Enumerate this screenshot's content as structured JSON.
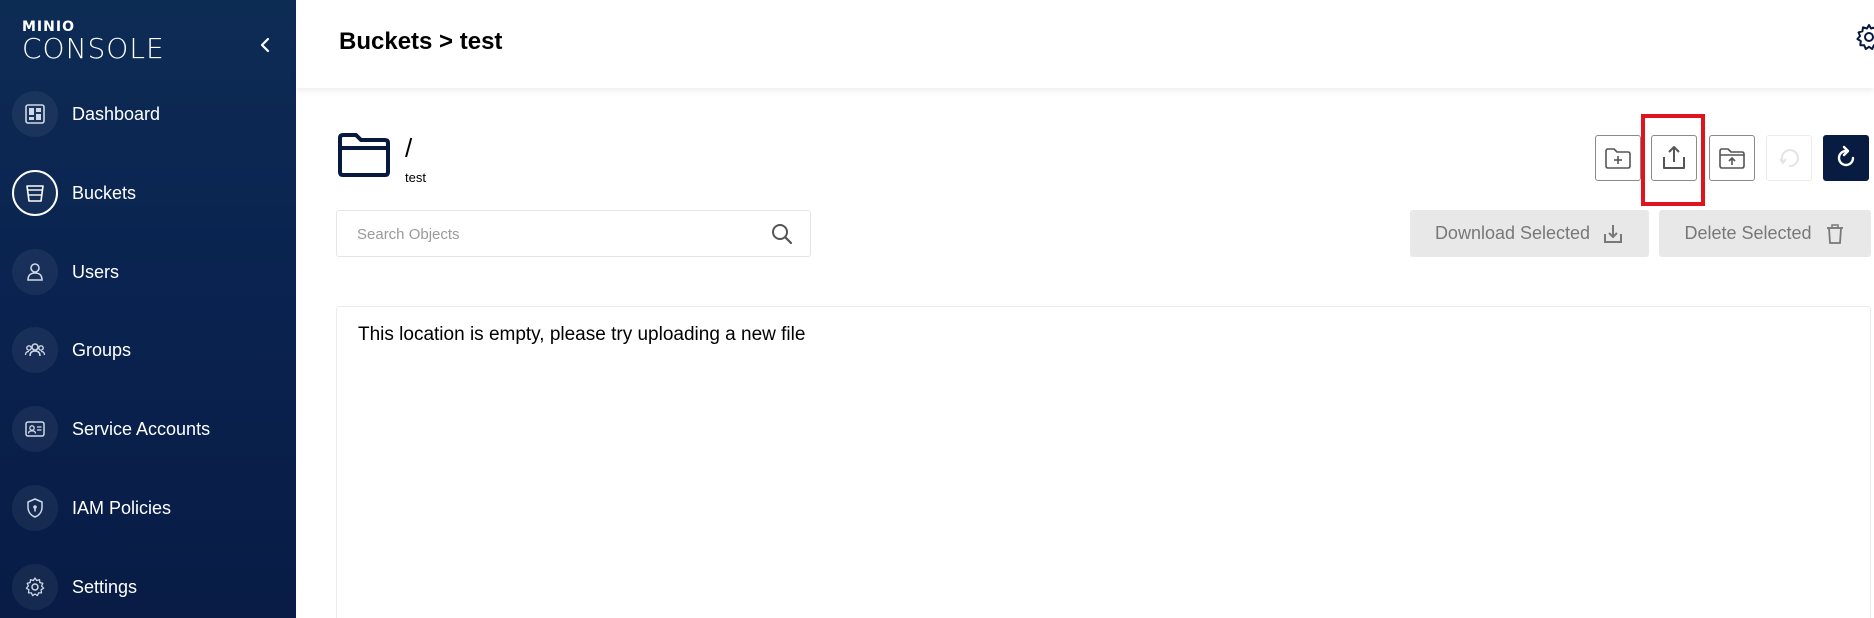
{
  "sidebar": {
    "logo": {
      "small": "MINIO",
      "big": "CONSOLE"
    },
    "items": [
      {
        "label": "Dashboard",
        "icon": "dashboard-icon"
      },
      {
        "label": "Buckets",
        "icon": "bucket-icon",
        "active": true
      },
      {
        "label": "Users",
        "icon": "user-icon"
      },
      {
        "label": "Groups",
        "icon": "groups-icon"
      },
      {
        "label": "Service Accounts",
        "icon": "service-accounts-icon"
      },
      {
        "label": "IAM Policies",
        "icon": "shield-icon"
      },
      {
        "label": "Settings",
        "icon": "gear-icon"
      }
    ]
  },
  "header": {
    "breadcrumb": "Buckets > test"
  },
  "location": {
    "path": "/",
    "bucket": "test"
  },
  "search": {
    "placeholder": "Search Objects",
    "value": ""
  },
  "toolbar": {
    "icons": [
      "create-folder-icon",
      "upload-file-icon",
      "upload-folder-icon",
      "rewind-icon",
      "refresh-icon"
    ],
    "download_label": "Download Selected",
    "delete_label": "Delete Selected"
  },
  "content": {
    "empty_message": "This location is empty, please try uploading a new file"
  },
  "colors": {
    "sidebar": "#0a2350",
    "highlight": "#e0141e",
    "refresh_button": "#081c42"
  }
}
